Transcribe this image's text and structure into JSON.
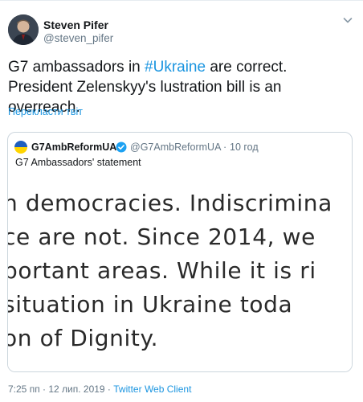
{
  "tweet": {
    "author_name": "Steven Pifer",
    "author_handle": "@steven_pifer",
    "text_before": "G7 ambassadors in ",
    "hashtag": "#Ukraine",
    "text_after": " are correct. President Zelenskyy's lustration bill is an overreach.",
    "translate_label": "Перекласти твіт",
    "timestamp": "7:25 пп · 12 лип. 2019 · ",
    "client": "Twitter Web Client"
  },
  "quoted": {
    "name": "G7AmbReformUA",
    "handle": "@G7AmbReformUA",
    "separator": "·",
    "time": "10 год",
    "text": "G7 Ambassadors' statement",
    "image_lines": [
      "n democracies. Indiscrimina",
      "ce are not. Since 2014, we",
      "portant areas. While it is ri",
      " situation in Ukraine toda",
      "on of Dignity."
    ]
  },
  "icons": {
    "caret": "chevron-down-icon",
    "verified": "verified-badge-icon",
    "flag": "ukraine-flag-icon",
    "avatar": "user-avatar"
  },
  "colors": {
    "link": "#1b95e0",
    "verified": "#1da1f2",
    "flag_blue": "#1f5fbf",
    "flag_yellow": "#ffd500"
  }
}
